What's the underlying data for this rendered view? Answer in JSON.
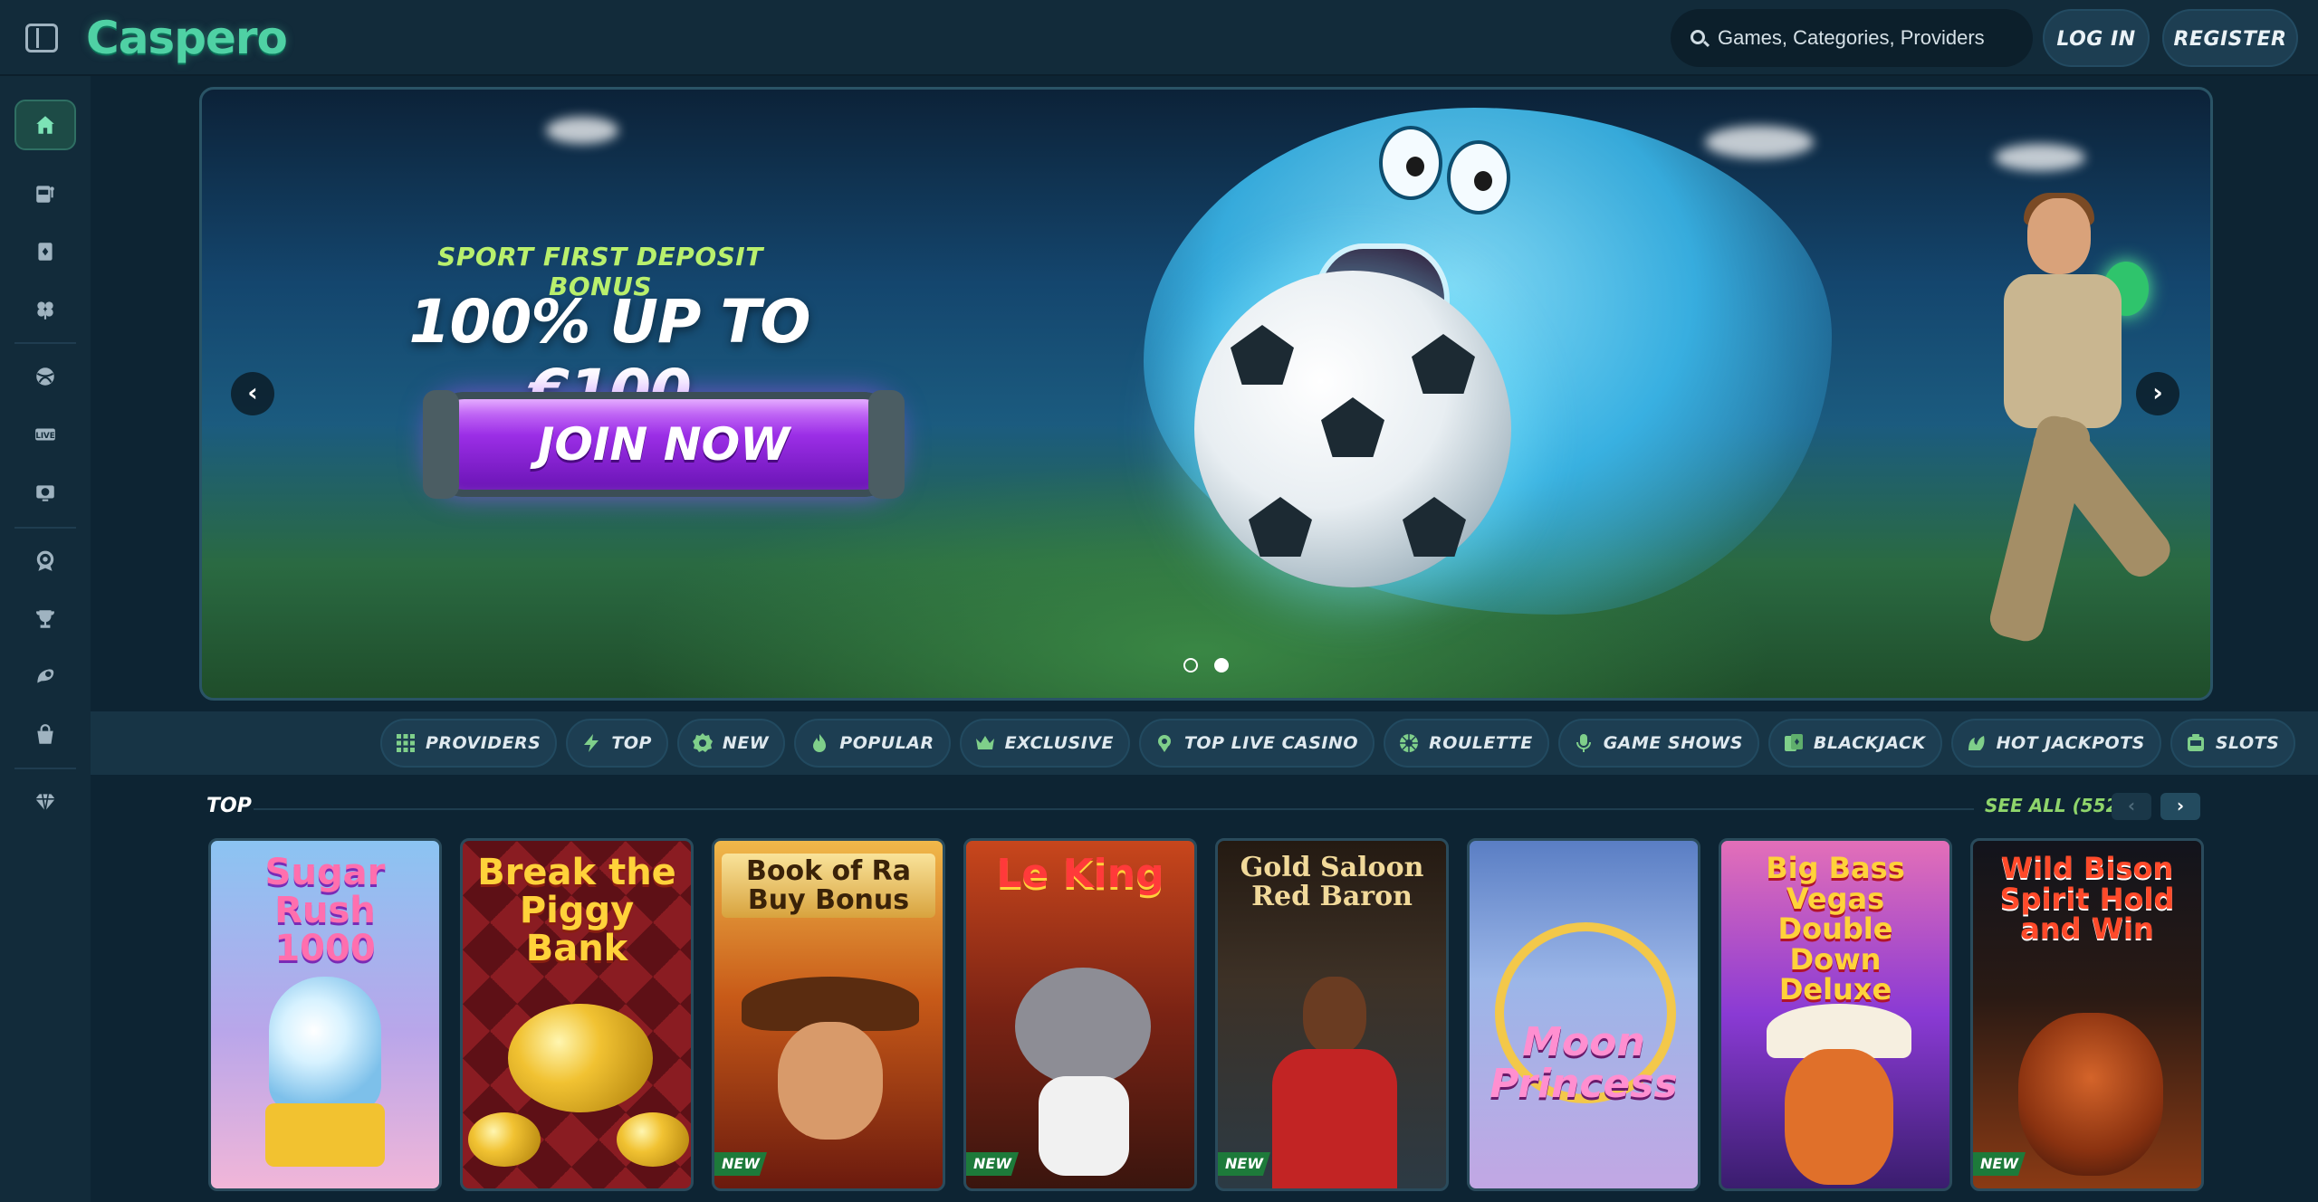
{
  "header": {
    "logo": "Caspero",
    "search_placeholder": "Games, Categories, Providers",
    "login_label": "LOG IN",
    "register_label": "REGISTER"
  },
  "sidebar": {
    "items": [
      {
        "icon": "gift-icon",
        "active": false
      },
      {
        "icon": "home-icon",
        "active": true
      },
      {
        "icon": "slot-machine-icon",
        "active": false
      },
      {
        "icon": "card-icon",
        "active": false
      },
      {
        "icon": "clover-icon",
        "active": false
      },
      {
        "icon": "sports-ball-icon",
        "active": false
      },
      {
        "icon": "live-icon",
        "active": false
      },
      {
        "icon": "virtual-sports-icon",
        "active": false
      },
      {
        "icon": "provider-icon",
        "active": false
      },
      {
        "icon": "trophy-icon",
        "active": false
      },
      {
        "icon": "bonus-icon",
        "active": false
      },
      {
        "icon": "shop-icon",
        "active": false
      },
      {
        "icon": "vip-diamond-icon",
        "active": false
      }
    ],
    "live_label": "LIVE"
  },
  "banner": {
    "subtitle": "SPORT FIRST DEPOSIT BONUS",
    "title": "100% UP TO €100",
    "cta": "JOIN NOW",
    "prev": "‹",
    "next": "›",
    "slides": 2,
    "active_slide": 2
  },
  "categories": [
    {
      "label": "PROVIDERS",
      "icon": "grid-icon"
    },
    {
      "label": "TOP",
      "icon": "lightning-icon"
    },
    {
      "label": "NEW",
      "icon": "new-badge-icon"
    },
    {
      "label": "POPULAR",
      "icon": "flame-icon"
    },
    {
      "label": "EXCLUSIVE",
      "icon": "crown-icon"
    },
    {
      "label": "TOP LIVE CASINO",
      "icon": "live-pin-icon"
    },
    {
      "label": "ROULETTE",
      "icon": "roulette-icon"
    },
    {
      "label": "GAME SHOWS",
      "icon": "microphone-icon"
    },
    {
      "label": "BLACKJACK",
      "icon": "blackjack-icon"
    },
    {
      "label": "HOT JACKPOTS",
      "icon": "jackpot-icon"
    },
    {
      "label": "SLOTS",
      "icon": "slots-icon"
    }
  ],
  "top_section": {
    "title": "TOP",
    "see_all": "SEE ALL (552)",
    "prev": "‹",
    "next": "›",
    "games": [
      {
        "title": "Sugar Rush 1000",
        "new": false
      },
      {
        "title": "Break the Piggy Bank",
        "new": false
      },
      {
        "title": "Book of Ra Buy Bonus",
        "new": true
      },
      {
        "title": "Le King",
        "new": true
      },
      {
        "title": "Gold Saloon Red Baron",
        "new": true
      },
      {
        "title": "Moon Princess",
        "new": false
      },
      {
        "title": "Big Bass Vegas Double Down Deluxe",
        "new": false
      },
      {
        "title": "Wild Bison Spirit Hold and Win",
        "new": true
      }
    ],
    "new_label": "NEW"
  },
  "colors": {
    "background": "#0d2433",
    "header": "#122b3a",
    "accent_green": "#4fd1a4",
    "lime": "#b9f06d",
    "cta_purple": "#9b2ee6"
  }
}
